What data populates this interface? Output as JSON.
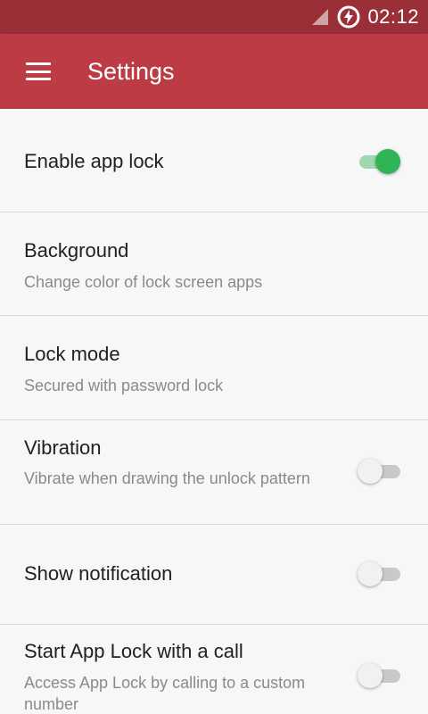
{
  "status_bar": {
    "time": "02:12",
    "icons": [
      "signal-icon",
      "data-saver-icon"
    ]
  },
  "app_bar": {
    "title": "Settings",
    "menu_icon": "hamburger-menu-icon",
    "color": "#bd3b45",
    "status_color": "#9a2f38"
  },
  "settings": [
    {
      "title": "Enable app lock",
      "summary": "",
      "toggle": true,
      "on": true
    },
    {
      "title": "Background",
      "summary": "Change color of lock screen apps",
      "toggle": false
    },
    {
      "title": "Lock mode",
      "summary": "Secured with password lock",
      "toggle": false
    },
    {
      "title": "Vibration",
      "summary": "Vibrate when drawing the unlock pattern",
      "toggle": true,
      "on": false
    },
    {
      "title": "Show notification",
      "summary": "",
      "toggle": true,
      "on": false
    },
    {
      "title": "Start App Lock with a call",
      "summary": "Access App Lock by calling to a custom number",
      "toggle": true,
      "on": false
    }
  ],
  "accent_color": "#2fb456"
}
